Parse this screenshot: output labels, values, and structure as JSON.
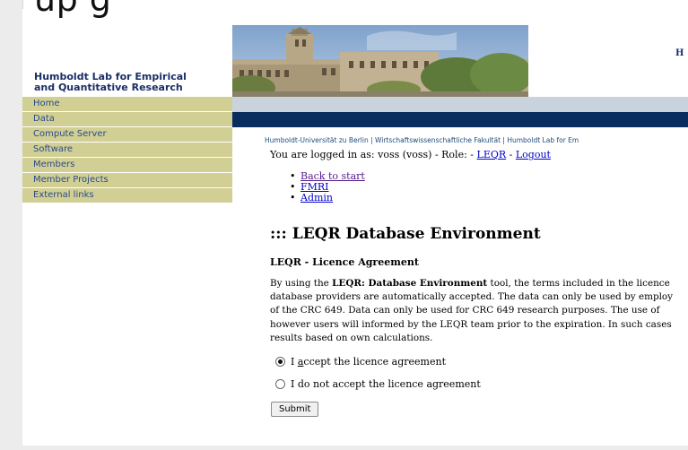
{
  "overlay": {
    "clipped_title": "up       g"
  },
  "header": {
    "lab_name_line1": "Humboldt Lab for Empirical",
    "lab_name_line2": "and Quantitative Research",
    "right_letter": "H"
  },
  "nav": {
    "items": [
      {
        "label": "Home"
      },
      {
        "label": "Data"
      },
      {
        "label": "Compute Server"
      },
      {
        "label": "Software"
      },
      {
        "label": "Members"
      },
      {
        "label": "Member Projects"
      },
      {
        "label": "External links"
      }
    ]
  },
  "breadcrumb": {
    "item1": "Humboldt-Universität zu Berlin",
    "sep": " | ",
    "item2": "Wirtschaftswissenschaftliche Fakultät",
    "item3": "Humboldt Lab for Em"
  },
  "login": {
    "prefix": "You are logged in as: voss (voss) - Role: - ",
    "role_link": "LEQR",
    "sep": " - ",
    "logout": "Logout"
  },
  "links": [
    {
      "label": "Back to start"
    },
    {
      "label": "FMRI"
    },
    {
      "label": "Admin"
    }
  ],
  "main": {
    "heading": "::: LEQR Database Environment",
    "subheading": "LEQR - Licence Agreement",
    "para": {
      "l1_pre": "By using the ",
      "l1_bold": "LEQR: Database Environment",
      "l1_post": " tool, the terms included in the licence",
      "l2": "database providers are automatically accepted. The data can only be used by employ",
      "l3": "of the CRC 649. Data can only be used for CRC 649 research purposes. The use of",
      "l4": "however users will informed by the LEQR team prior to the expiration. In such cases",
      "l5": "results based on own calculations."
    }
  },
  "form": {
    "accept_label_pre": "I ",
    "accept_label_u": "a",
    "accept_label_post": "ccept the licence agreement",
    "accept_selected": true,
    "decline_label": "I do not accept the licence agreement",
    "decline_selected": false,
    "submit_label": "Submit"
  },
  "colors": {
    "nav_bg": "#d1cf94",
    "nav_text": "#2a4a8a",
    "band_grey": "#c9d3de",
    "band_navy": "#0a2d60",
    "lab_text": "#1a2e66"
  }
}
